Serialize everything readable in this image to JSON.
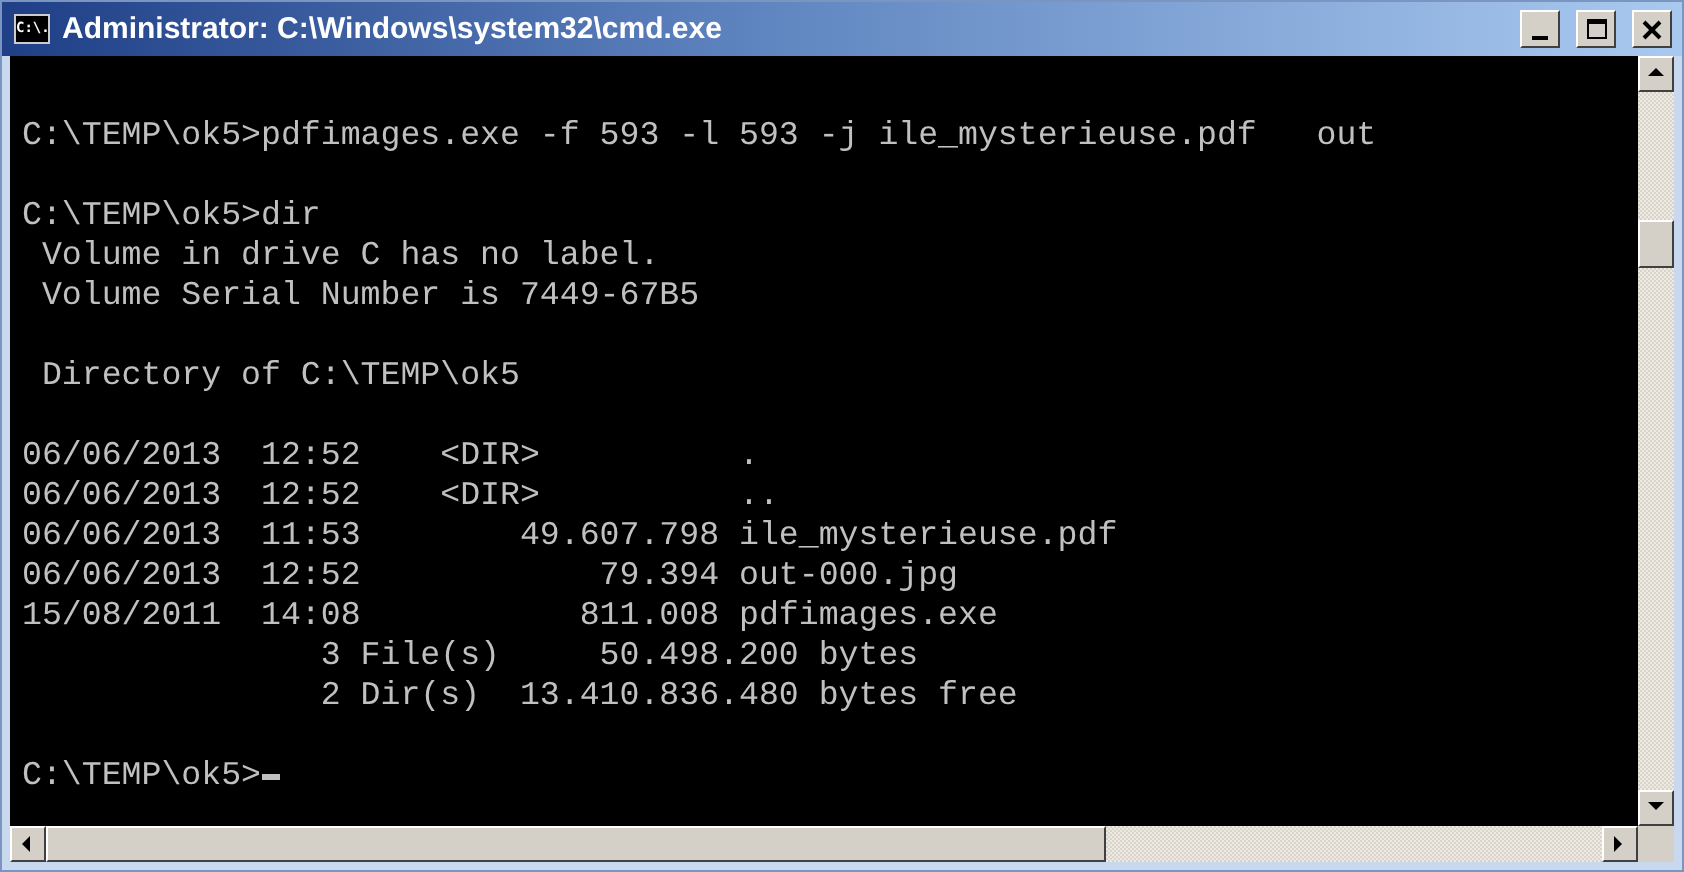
{
  "window": {
    "title": "Administrator: C:\\Windows\\system32\\cmd.exe",
    "icon_text": "C:\\."
  },
  "console": {
    "blocks": [
      [
        "C:\\TEMP\\ok5>pdfimages.exe -f 593 -l 593 -j ile_mysterieuse.pdf   out"
      ],
      [
        "C:\\TEMP\\ok5>dir",
        " Volume in drive C has no label.",
        " Volume Serial Number is 7449-67B5"
      ],
      [
        " Directory of C:\\TEMP\\ok5"
      ],
      [
        "06/06/2013  12:52    <DIR>          .",
        "06/06/2013  12:52    <DIR>          ..",
        "06/06/2013  11:53        49.607.798 ile_mysterieuse.pdf",
        "06/06/2013  12:52            79.394 out-000.jpg",
        "15/08/2011  14:08           811.008 pdfimages.exe",
        "               3 File(s)     50.498.200 bytes",
        "               2 Dir(s)  13.410.836.480 bytes free"
      ]
    ],
    "prompt": "C:\\TEMP\\ok5>",
    "cursor": true
  }
}
